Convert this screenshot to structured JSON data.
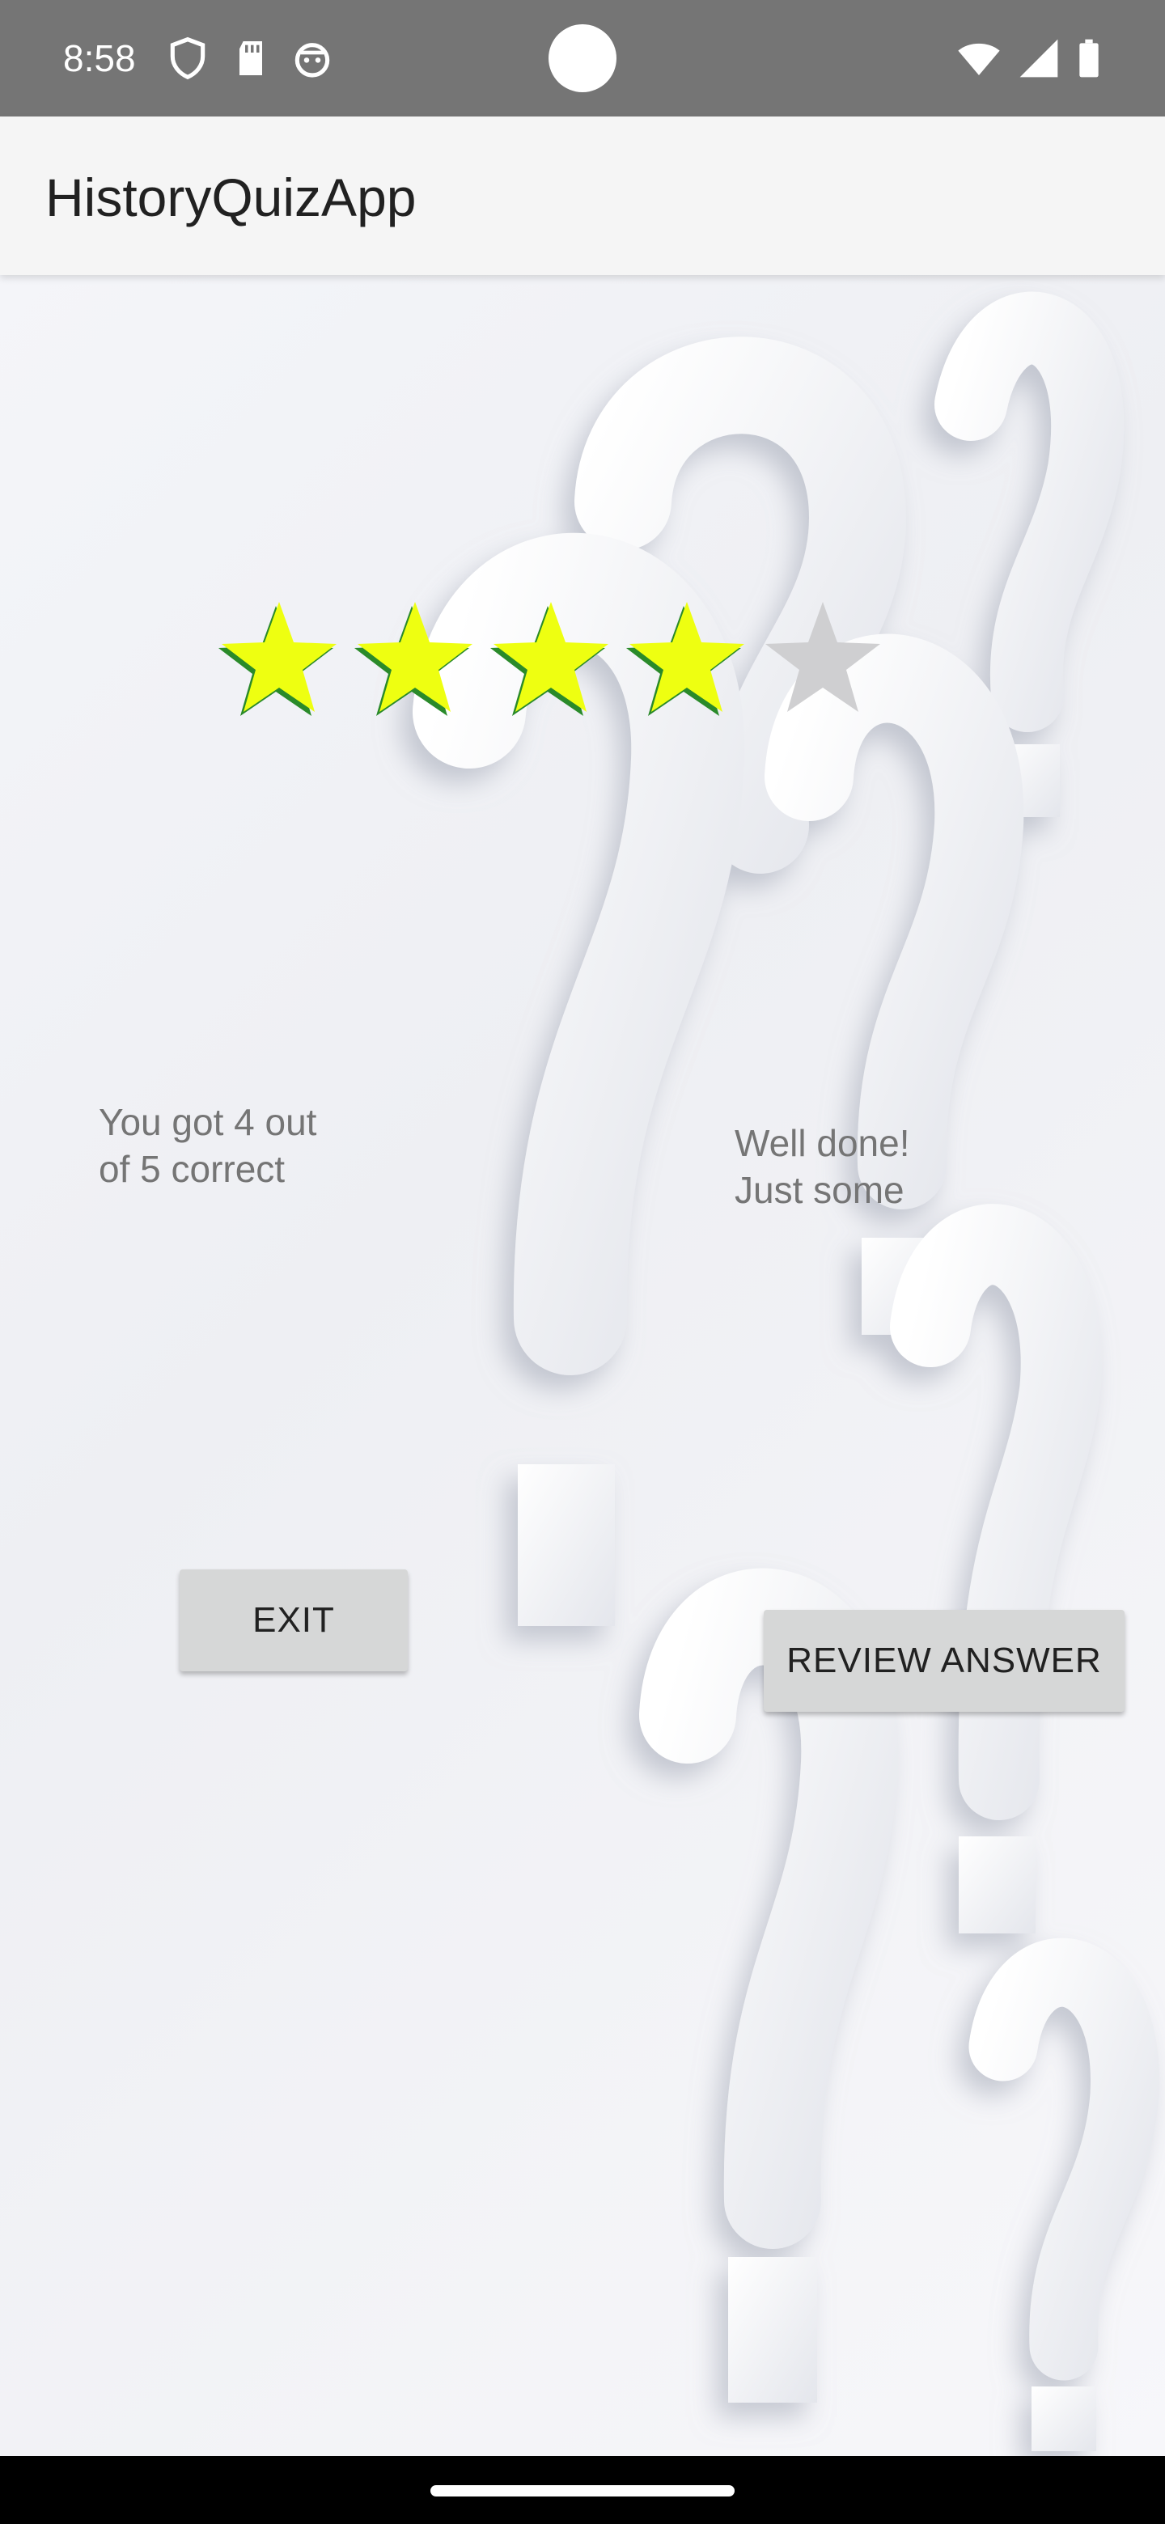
{
  "status_bar": {
    "time": "8:58",
    "icons": [
      "shield-icon",
      "sd-card-icon",
      "robot-icon",
      "wifi-icon",
      "signal-icon",
      "battery-icon"
    ]
  },
  "app_bar": {
    "title": "HistoryQuizApp"
  },
  "rating": {
    "value": 4,
    "max": 5,
    "filled_color": "#eeff11",
    "empty_color": "#cfcfd1"
  },
  "result": {
    "score_text": "You got 4 out of 5 correct",
    "feedback_text": "Well done! Just some"
  },
  "buttons": {
    "exit_label": "EXIT",
    "review_label": "REVIEW ANSWER"
  },
  "colors": {
    "status_bar": "#757575",
    "app_bar": "#f5f5f5",
    "button_bg": "#d6d7d7",
    "text_muted": "#757575"
  }
}
